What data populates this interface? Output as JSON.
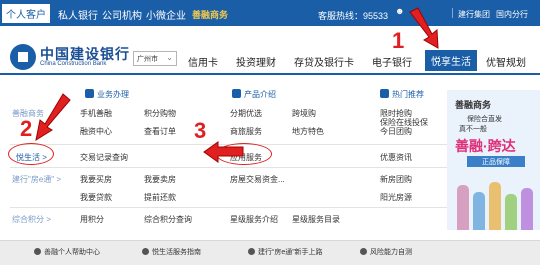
{
  "topbar": {
    "items": [
      "个人客户",
      "私人银行",
      "公司机构",
      "小微企业"
    ],
    "shanrong": "善融商务",
    "hotline": "客服热线：95533",
    "links": [
      "建行集团",
      "国内分行"
    ]
  },
  "logo": {
    "cn": "中国建设银行",
    "en": "China Construction Bank"
  },
  "city": {
    "value": "广州市"
  },
  "nav": [
    "信用卡",
    "投资理财",
    "存贷及银行卡",
    "电子银行",
    "悦享生活",
    "优智规划"
  ],
  "sections": {
    "business": "业务办理",
    "products": "产品介绍",
    "hot": "热门推荐"
  },
  "categories": {
    "shanrong": "善融商务",
    "life": "悦生活 >",
    "house": "建行\"房e通\" >",
    "points": "综合积分 >"
  },
  "links": {
    "b1": "手机善融",
    "b2": "积分购物",
    "b3": "融资中心",
    "b4": "查看订单",
    "b5": "交易记录查询",
    "b6": "我要买房",
    "b7": "我要卖房",
    "b8": "我要贷款",
    "b9": "提前还款",
    "b10": "用积分",
    "b11": "综合积分查询",
    "p1": "分期优选",
    "p2": "跨境购",
    "p3": "商旅服务",
    "p4": "地方特色",
    "p5": "应用服务",
    "p6": "房屋交易资金...",
    "p7": "星级服务介绍",
    "p8": "星级服务目录",
    "h1": "限时抢购",
    "h2": "保险在线投保",
    "h3": "今日团购",
    "h4": "优惠资讯",
    "h5": "新房团购",
    "h6": "阳光房源"
  },
  "ad": {
    "title": "善融商务",
    "line1": "保险合直发",
    "line2": "真不一般",
    "slogan": "善融·跨达",
    "button": "正品保障"
  },
  "footer": [
    "善融个人帮助中心",
    "悦生活服务指南",
    "建行“房e通”新手上路",
    "风险能力自测"
  ],
  "annotations": [
    "1",
    "2",
    "3"
  ],
  "colors": {
    "brand": "#1a5ea8",
    "annotation": "#e02020",
    "footer_bg": "#ececec"
  }
}
